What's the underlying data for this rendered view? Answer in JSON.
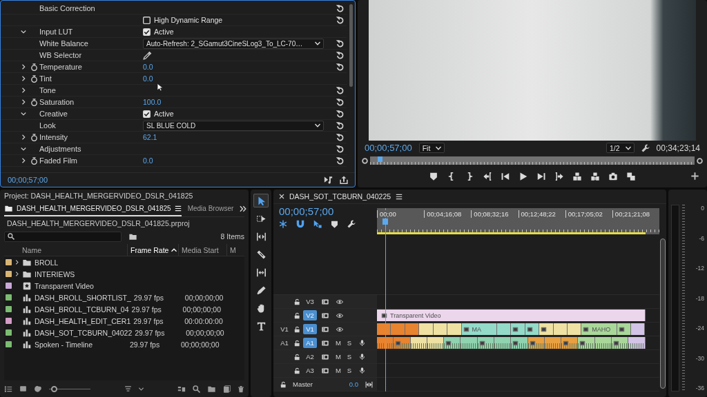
{
  "effect_controls": {
    "rows": [
      {
        "label": "Basic Correction",
        "reset": true
      },
      {
        "control": {
          "kind": "checkbox",
          "label": "High Dynamic Range",
          "checked": false
        },
        "reset": true
      },
      {
        "label": "Input LUT",
        "expanded": true,
        "control": {
          "kind": "checkbox",
          "label": "Active",
          "checked": true
        }
      },
      {
        "label": "White Balance",
        "control": {
          "kind": "dropdown",
          "value": "Auto-Refresh: 2_SGamut3CineSLog3_To_LC-70…"
        },
        "reset": true
      },
      {
        "label": "WB Selector",
        "control": {
          "kind": "eyedropper"
        },
        "reset": true
      },
      {
        "label": "Temperature",
        "expanded": false,
        "stopwatch": true,
        "control": {
          "kind": "value",
          "value": "0.0"
        },
        "reset": true
      },
      {
        "label": "Tint",
        "expanded": false,
        "stopwatch": true,
        "control": {
          "kind": "value",
          "value": "0.0"
        }
      },
      {
        "label": "Tone",
        "expanded": false,
        "reset": true
      },
      {
        "label": "Saturation",
        "expanded": false,
        "stopwatch": true,
        "control": {
          "kind": "value",
          "value": "100.0"
        },
        "reset": true
      },
      {
        "label": "Creative",
        "expanded": true,
        "control": {
          "kind": "checkbox",
          "label": "Active",
          "checked": true
        },
        "reset": true
      },
      {
        "label": "Look",
        "control": {
          "kind": "dropdown",
          "value": "SL BLUE COLD"
        },
        "reset": true
      },
      {
        "label": "Intensity",
        "expanded": false,
        "stopwatch": true,
        "control": {
          "kind": "value",
          "value": "62.1"
        },
        "reset": true
      },
      {
        "label": "Adjustments",
        "expanded": true,
        "reset": true
      },
      {
        "label": "Faded Film",
        "expanded": false,
        "stopwatch": true,
        "control": {
          "kind": "value",
          "value": "0.0"
        },
        "reset": true
      }
    ],
    "timecode": "00;00;57;00"
  },
  "program_monitor": {
    "timecode": "00;00;57;00",
    "zoom": "Fit",
    "resolution": "1/2",
    "duration": "00;34;23;14",
    "scrubber": {
      "level": 0.03
    }
  },
  "project": {
    "title": "Project: DASH_HEALTH_MERGERVIDEO_DSLR_041825",
    "tabs": [
      {
        "kind": "project",
        "label": "DASH_HEALTH_MERGERVIDEO_DSLR_041825",
        "selected": true
      },
      {
        "kind": "browser",
        "label": "Media Browser",
        "selected": false
      }
    ],
    "file": "DASH_HEALTH_MERGERVIDEO_DSLR_041825.prproj",
    "count": "8 Items",
    "columns": [
      {
        "label": "Name",
        "sorted": false
      },
      {
        "label": "Frame Rate",
        "sorted": true
      },
      {
        "label": "Media Start",
        "sorted": false
      },
      {
        "label": "M",
        "sorted": false
      }
    ],
    "rows": [
      {
        "kind": "bin",
        "name": "BROLL",
        "color": "#d8b574",
        "expanded": false
      },
      {
        "kind": "bin",
        "name": "INTERIEWS",
        "color": "#d8b574",
        "expanded": false
      },
      {
        "kind": "item",
        "name": "Transparent Video",
        "color": "#c9a8d8"
      },
      {
        "kind": "sequence",
        "name": "DASH_BROLL_SHORTLIST_",
        "color": "#7cbb72",
        "frame_rate": "29.97 fps",
        "media_start": "00;00;00;00"
      },
      {
        "kind": "sequence",
        "name": "DASH_BROLL_TCBURN_04",
        "color": "#7cbb72",
        "frame_rate": "29.97 fps",
        "media_start": "00;00;00;00"
      },
      {
        "kind": "sequence",
        "name": "DASH_HEALTH_EDIT_CER1",
        "color": "#d59cc6",
        "frame_rate": "29.97 fps",
        "media_start": "00:00:00:00"
      },
      {
        "kind": "sequence",
        "name": "DASH_SOT_TCBURN_04022",
        "color": "#7cbb72",
        "frame_rate": "29.97 fps",
        "media_start": "00;00;00;00"
      },
      {
        "kind": "sequence",
        "name": "Spoken - Timeline",
        "color": "#7cbb72",
        "frame_rate": "29.97 fps",
        "media_start": "00;00;00;00"
      }
    ],
    "zoom_slider": {
      "level": 0.05
    }
  },
  "tools": [
    {
      "kind": "selection",
      "selected": true
    },
    {
      "kind": "track-select",
      "selected": false
    },
    {
      "kind": "ripple",
      "selected": false
    },
    {
      "kind": "razor",
      "selected": false
    },
    {
      "kind": "slip",
      "selected": false
    },
    {
      "kind": "pen",
      "selected": false
    },
    {
      "kind": "hand",
      "selected": false
    },
    {
      "kind": "type",
      "selected": false
    }
  ],
  "timeline": {
    "title": "DASH_SOT_TCBURN_040225",
    "timecode": "00;00;57;00",
    "toggles": [
      {
        "kind": "nest",
        "on": true
      },
      {
        "kind": "snap",
        "on": true
      },
      {
        "kind": "linked",
        "on": true
      }
    ],
    "ruler": {
      "labels": [
        "00;00",
        "00;04;16;08",
        "00;08;32;16",
        "00;12;48;22",
        "00;17;05;02",
        "00;21;21;08"
      ]
    },
    "playhead": {
      "level": 0.03
    },
    "tracks": [
      {
        "kind": "video",
        "name": "V3",
        "targeted": false
      },
      {
        "kind": "video",
        "name": "V2",
        "targeted": true,
        "clips": [
          {
            "label": "Transparent Video",
            "color": "#ecd6ec",
            "fx": true
          }
        ]
      },
      {
        "kind": "video",
        "name": "V1",
        "source": "V1",
        "targeted": true,
        "clips": [
          {
            "color": "#e8832f"
          },
          {
            "color": "#e8832f"
          },
          {
            "color": "#e8832f"
          },
          {
            "color": "#eee1a2"
          },
          {
            "color": "#eee1a2"
          },
          {
            "color": "#eee1a2"
          },
          {
            "label": "MA",
            "color": "#93dac9",
            "fx": true
          },
          {
            "color": "#93dac9"
          },
          {
            "color": "#93dac9",
            "fx": true
          },
          {
            "color": "#93dac9",
            "fx": true
          },
          {
            "color": "#eee1a2",
            "fx": true
          },
          {
            "color": "#eee1a2"
          },
          {
            "color": "#eee1a2"
          },
          {
            "label": "MAHO",
            "color": "#a9d79a",
            "fx": true
          },
          {
            "color": "#a9d79a",
            "fx": true
          },
          {
            "color": "#d3c3e6"
          }
        ]
      },
      {
        "kind": "audio",
        "name": "A1",
        "source": "A1",
        "targeted": true,
        "mute": "M",
        "solo": "S",
        "clips": [
          {
            "color": "#e8832f"
          },
          {
            "color": "#e8832f",
            "fx": true
          },
          {
            "color": "#eee1a2"
          },
          {
            "color": "#eee1a2"
          },
          {
            "color": "#8fd3b0",
            "fx": true
          },
          {
            "color": "#8fd3b0"
          },
          {
            "color": "#8fd3b0",
            "fx": true
          },
          {
            "color": "#8fd3b0"
          },
          {
            "color": "#8fd3b0",
            "fx": true
          },
          {
            "color": "#e8a040",
            "fx": true
          },
          {
            "color": "#e8a040"
          },
          {
            "color": "#e8a040",
            "fx": true
          },
          {
            "color": "#a9d79a",
            "fx": true
          },
          {
            "color": "#a9d79a"
          },
          {
            "color": "#a9d79a",
            "fx": true
          },
          {
            "color": "#d3c3e6"
          }
        ]
      },
      {
        "kind": "audio",
        "name": "A2",
        "targeted": false,
        "mute": "M",
        "solo": "S"
      },
      {
        "kind": "audio",
        "name": "A3",
        "targeted": false,
        "mute": "M",
        "solo": "S"
      },
      {
        "kind": "master",
        "name": "Master",
        "value": "0.0"
      }
    ]
  },
  "audio_meter": {
    "scale": [
      "0",
      "-6",
      "-12",
      "-18",
      "-24",
      "-30",
      "-36"
    ]
  }
}
